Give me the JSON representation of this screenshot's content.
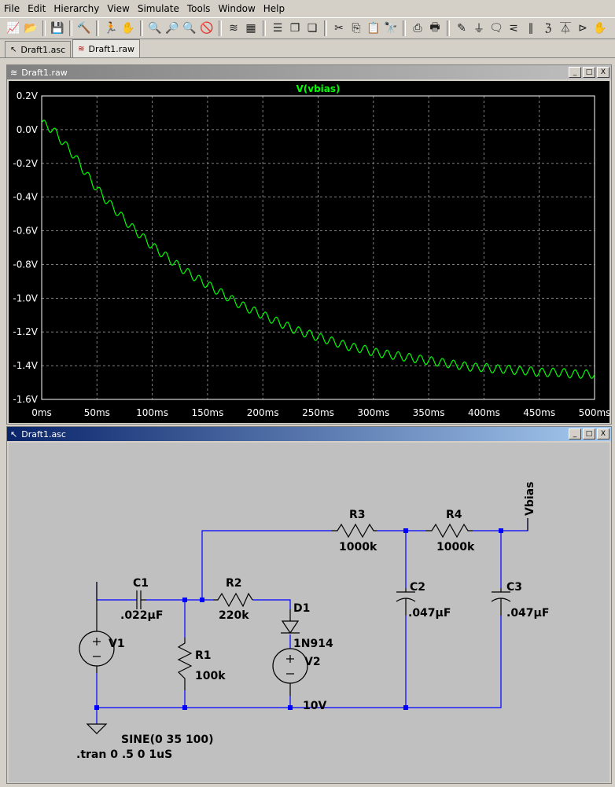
{
  "menu": [
    "File",
    "Edit",
    "Hierarchy",
    "View",
    "Simulate",
    "Tools",
    "Window",
    "Help"
  ],
  "tabs": [
    {
      "label": "Draft1.asc",
      "icon": "schematic-tab-icon"
    },
    {
      "label": "Draft1.raw",
      "icon": "waveform-tab-icon"
    }
  ],
  "waveform_window": {
    "title": "Draft1.raw"
  },
  "schematic_window": {
    "title": "Draft1.asc"
  },
  "window_buttons": {
    "minimize": "_",
    "maximize": "□",
    "close": "X"
  },
  "colors": {
    "trace": "#00ff00",
    "grid": "#808080",
    "wire": "#0000ff",
    "component": "#000000",
    "background": "#000000"
  },
  "chart_data": {
    "type": "line",
    "title": "V(vbias)",
    "xlabel": "",
    "ylabel": "",
    "xlim": [
      0,
      500
    ],
    "ylim": [
      -1.6,
      0.2
    ],
    "x_ticks": [
      "0ms",
      "50ms",
      "100ms",
      "150ms",
      "200ms",
      "250ms",
      "300ms",
      "350ms",
      "400ms",
      "450ms",
      "500ms"
    ],
    "y_ticks": [
      "0.2V",
      "0.0V",
      "-0.2V",
      "-0.4V",
      "-0.6V",
      "-0.8V",
      "-1.0V",
      "-1.2V",
      "-1.4V",
      "-1.6V"
    ],
    "grid": true,
    "series": [
      {
        "name": "V(vbias)",
        "color": "#00ff00",
        "x": [
          0,
          10,
          20,
          30,
          40,
          50,
          60,
          70,
          80,
          90,
          100,
          110,
          120,
          130,
          140,
          150,
          160,
          170,
          180,
          190,
          200,
          210,
          220,
          230,
          240,
          250,
          260,
          270,
          280,
          290,
          300,
          310,
          320,
          330,
          340,
          350,
          360,
          370,
          380,
          390,
          400,
          410,
          420,
          430,
          440,
          450,
          460,
          470,
          480,
          490,
          500
        ],
        "y": [
          0.04,
          0.0,
          -0.08,
          -0.16,
          -0.26,
          -0.35,
          -0.43,
          -0.5,
          -0.57,
          -0.63,
          -0.69,
          -0.74,
          -0.79,
          -0.84,
          -0.88,
          -0.92,
          -0.96,
          -1.0,
          -1.04,
          -1.07,
          -1.1,
          -1.13,
          -1.16,
          -1.19,
          -1.21,
          -1.23,
          -1.25,
          -1.27,
          -1.29,
          -1.3,
          -1.32,
          -1.33,
          -1.34,
          -1.35,
          -1.36,
          -1.37,
          -1.38,
          -1.39,
          -1.4,
          -1.41,
          -1.41,
          -1.42,
          -1.42,
          -1.43,
          -1.43,
          -1.44,
          -1.44,
          -1.44,
          -1.45,
          -1.45,
          -1.45
        ],
        "ripple_amplitude": 0.025,
        "ripple_frequency_hz": 100
      }
    ]
  },
  "schematic": {
    "components": {
      "C1": {
        "name": "C1",
        "value": ".022µF"
      },
      "R2": {
        "name": "R2",
        "value": "220k"
      },
      "D1": {
        "name": "D1",
        "value": "1N914"
      },
      "V1": {
        "name": "V1",
        "value": "SINE(0 35 100)"
      },
      "R1": {
        "name": "R1",
        "value": "100k"
      },
      "V2": {
        "name": "V2",
        "value": "10V"
      },
      "R3": {
        "name": "R3",
        "value": "1000k"
      },
      "R4": {
        "name": "R4",
        "value": "1000k"
      },
      "C2": {
        "name": "C2",
        "value": ".047µF"
      },
      "C3": {
        "name": "C3",
        "value": ".047µF"
      }
    },
    "net_label": "Vbias",
    "directive": ".tran 0 .5 0 1uS"
  }
}
